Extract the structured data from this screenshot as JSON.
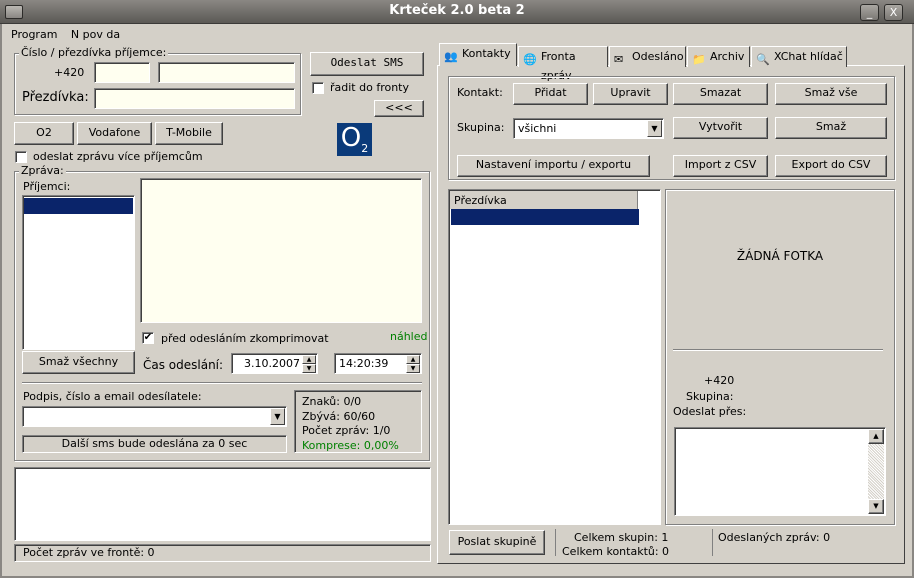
{
  "window": {
    "title": "Krteček 2.0 beta 2",
    "minimize": "_",
    "close": "X"
  },
  "menu": [
    "Program",
    "N pov da"
  ],
  "recipient": {
    "legend": "Číslo / přezdívka příjemce:",
    "prefix": "+420",
    "nickname_label": "Přezdívka:"
  },
  "send_sms_label": "Odeslat SMS",
  "queue_checkbox_label": "řadit do fronty",
  "collapse_button": "<<<",
  "operators": [
    "O2",
    "Vodafone",
    "T-Mobile"
  ],
  "o2_logo": {
    "text": "O",
    "sub": "2",
    "color": "#0a3a7a"
  },
  "multi_recipient_label": "odeslat zprávu více příjemcům",
  "message": {
    "legend": "Zpráva:",
    "recipients_label": "Příjemci:",
    "clear_all": "Smaž všechny",
    "compress_label": "před odesláním zkomprimovat",
    "preview_link": "náhled",
    "send_time_label": "Čas odeslání:",
    "date": "3.10.2007",
    "time": "14:20:39",
    "signature_label": "Podpis, číslo a email odesílatele:",
    "next_sms": "Další sms bude odeslána za 0 sec"
  },
  "stats": {
    "chars": "Znaků: 0/0",
    "remaining": "Zbývá: 60/60",
    "count": "Počet zpráv: 1/0",
    "compression": "Komprese: 0,00%",
    "compression_color": "#008000"
  },
  "queue_status": "Počet zpráv ve frontě: 0",
  "tabs": [
    {
      "label": "Kontakty",
      "icon": "people-icon"
    },
    {
      "label": "Fronta zpráv",
      "icon": "globe-icon"
    },
    {
      "label": "Odesláno",
      "icon": "tray-icon"
    },
    {
      "label": "Archiv",
      "icon": "archive-icon"
    },
    {
      "label": "XChat hlídač",
      "icon": "magnifier-icon"
    }
  ],
  "contacts": {
    "contact_label": "Kontakt:",
    "add": "Přidat",
    "edit": "Upravit",
    "delete": "Smazat",
    "delete_all": "Smaž vše",
    "group_label": "Skupina:",
    "group_value": "všichni",
    "create": "Vytvořit",
    "group_delete": "Smaž",
    "import_export_settings": "Nastavení importu / exportu",
    "import_csv": "Import z CSV",
    "export_csv": "Export do CSV",
    "list_header": "Přezdívka",
    "no_photo": "ŽÁDNÁ FOTKA",
    "detail_prefix": "+420",
    "detail_group_label": "Skupina:",
    "detail_send_via_label": "Odeslat přes:",
    "send_to_group": "Poslat skupině",
    "total_groups": "Celkem skupin: 1",
    "total_contacts": "Celkem kontaktů: 0",
    "sent_messages": "Odeslaných zpráv: 0"
  }
}
